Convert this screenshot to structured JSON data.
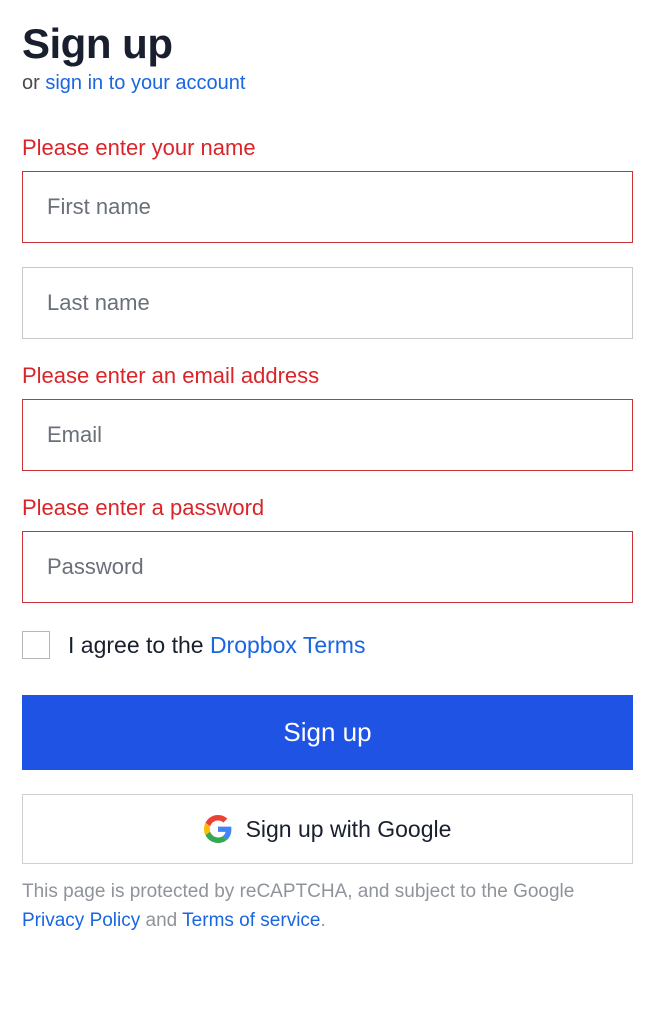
{
  "heading": "Sign up",
  "subheading_prefix": "or ",
  "subheading_link": "sign in to your account",
  "errors": {
    "name": "Please enter your name",
    "email": "Please enter an email address",
    "password": "Please enter a password"
  },
  "placeholders": {
    "first_name": "First name",
    "last_name": "Last name",
    "email": "Email",
    "password": "Password"
  },
  "terms": {
    "prefix": "I agree to the ",
    "link": "Dropbox Terms"
  },
  "buttons": {
    "signup": "Sign up",
    "google": "Sign up with Google"
  },
  "footer": {
    "text1": "This page is protected by reCAPTCHA, and subject to the Google ",
    "privacy": "Privacy Policy",
    "and": " and ",
    "tos": "Terms of service",
    "period": "."
  }
}
